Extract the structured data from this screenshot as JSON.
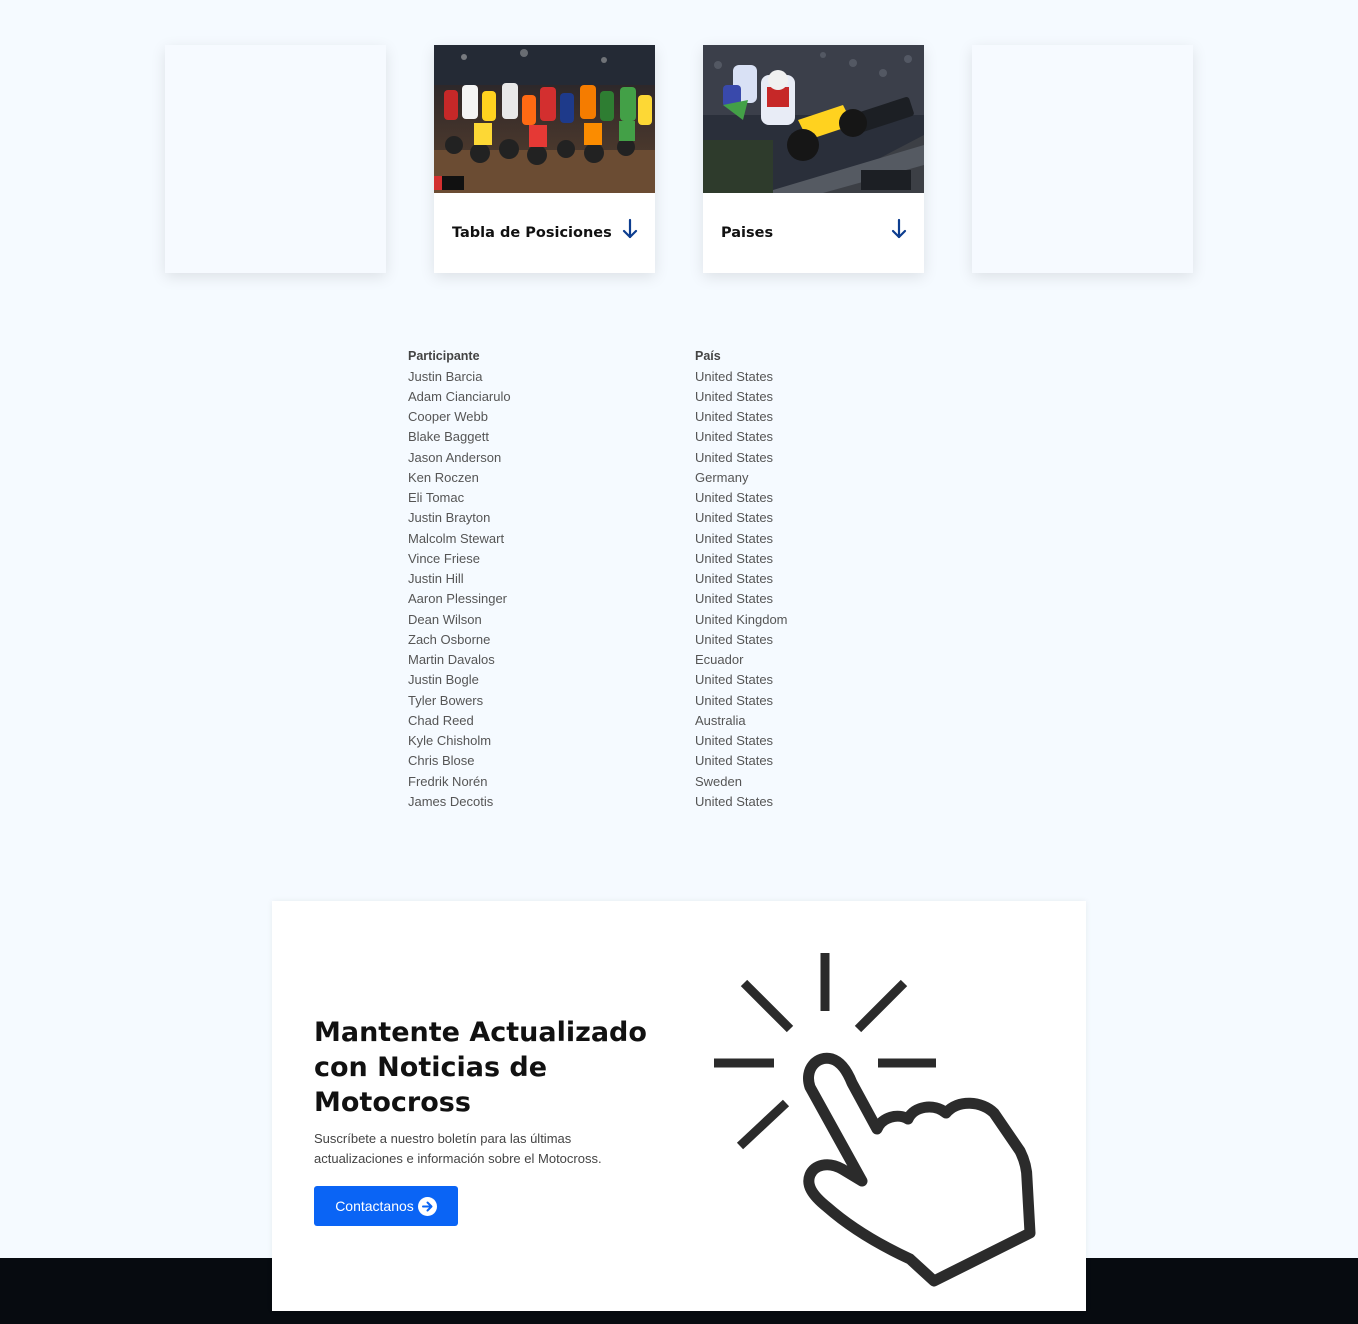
{
  "cards": [
    {
      "title": ""
    },
    {
      "title": "Tabla de Posiciones",
      "icon": "arrow-down-icon"
    },
    {
      "title": "Paises",
      "icon": "arrow-down-icon"
    },
    {
      "title": ""
    }
  ],
  "table": {
    "headers": [
      "Participante",
      "País"
    ],
    "rows": [
      [
        "Justin Barcia",
        "United States"
      ],
      [
        "Adam Cianciarulo",
        "United States"
      ],
      [
        "Cooper Webb",
        "United States"
      ],
      [
        "Blake Baggett",
        "United States"
      ],
      [
        "Jason Anderson",
        "United States"
      ],
      [
        "Ken Roczen",
        "Germany"
      ],
      [
        "Eli Tomac",
        "United States"
      ],
      [
        "Justin Brayton",
        "United States"
      ],
      [
        "Malcolm Stewart",
        "United States"
      ],
      [
        "Vince Friese",
        "United States"
      ],
      [
        "Justin Hill",
        "United States"
      ],
      [
        "Aaron Plessinger",
        "United States"
      ],
      [
        "Dean Wilson",
        "United Kingdom"
      ],
      [
        "Zach Osborne",
        "United States"
      ],
      [
        "Martin Davalos",
        "Ecuador"
      ],
      [
        "Justin Bogle",
        "United States"
      ],
      [
        "Tyler Bowers",
        "United States"
      ],
      [
        "Chad Reed",
        "Australia"
      ],
      [
        "Kyle Chisholm",
        "United States"
      ],
      [
        "Chris Blose",
        "United States"
      ],
      [
        "Fredrik Norén",
        "Sweden"
      ],
      [
        "James Decotis",
        "United States"
      ]
    ]
  },
  "newsletter": {
    "title": "Mantente Actualizado con Noticias de Motocross",
    "text": "Suscríbete a nuestro boletín para las últimas actualizaciones e información sobre el Motocross.",
    "button_label": "Contactanos",
    "button_icon": "arrow-circle-right-icon",
    "illustration_icon": "hand-pointer-click-icon"
  },
  "colors": {
    "background": "#f5faff",
    "accent": "#0a64f5",
    "arrow": "#0d3d8f",
    "footer": "#070b10"
  }
}
